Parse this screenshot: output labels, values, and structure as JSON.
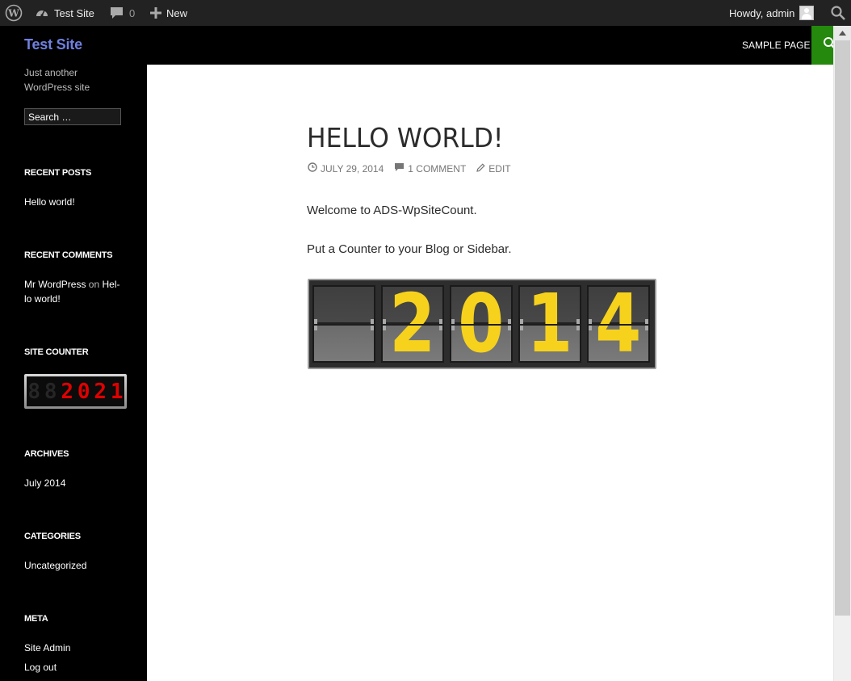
{
  "admin_bar": {
    "site_name": "Test Site",
    "comment_count": "0",
    "new_label": "New",
    "howdy": "Howdy, admin"
  },
  "site": {
    "title": "Test Site",
    "description": "Just another WordPress site"
  },
  "search": {
    "placeholder": "Search …"
  },
  "nav": {
    "sample_page": "SAMPLE PAGE"
  },
  "widgets": {
    "recent_posts": {
      "title": "RECENT POSTS",
      "items": [
        "Hello world!"
      ]
    },
    "recent_comments": {
      "title": "RECENT COMMENTS",
      "author": "Mr WordPress",
      "on": "on",
      "post": "Hel-lo world!"
    },
    "site_counter": {
      "title": "SITE COUNTER",
      "digits": [
        "8",
        "8",
        "2",
        "0",
        "2",
        "1"
      ],
      "lit_from": 2
    },
    "archives": {
      "title": "ARCHIVES",
      "items": [
        "July 2014"
      ]
    },
    "categories": {
      "title": "CATEGORIES",
      "items": [
        "Uncategorized"
      ]
    },
    "meta": {
      "title": "META",
      "items": [
        "Site Admin",
        "Log out"
      ]
    }
  },
  "post": {
    "title": "HELLO WORLD!",
    "date": "JULY 29, 2014",
    "comments": "1 COMMENT",
    "edit": "EDIT",
    "paragraphs": [
      "Welcome to ADS-WpSiteCount.",
      "Put a Counter to your Blog or Sidebar."
    ],
    "counter_digits": [
      "",
      "2",
      "0",
      "1",
      "4"
    ]
  },
  "colors": {
    "accent_green": "#24890d",
    "site_title": "#6f80e0",
    "counter_digit": "#f6d21c",
    "led_on": "#e00000"
  }
}
